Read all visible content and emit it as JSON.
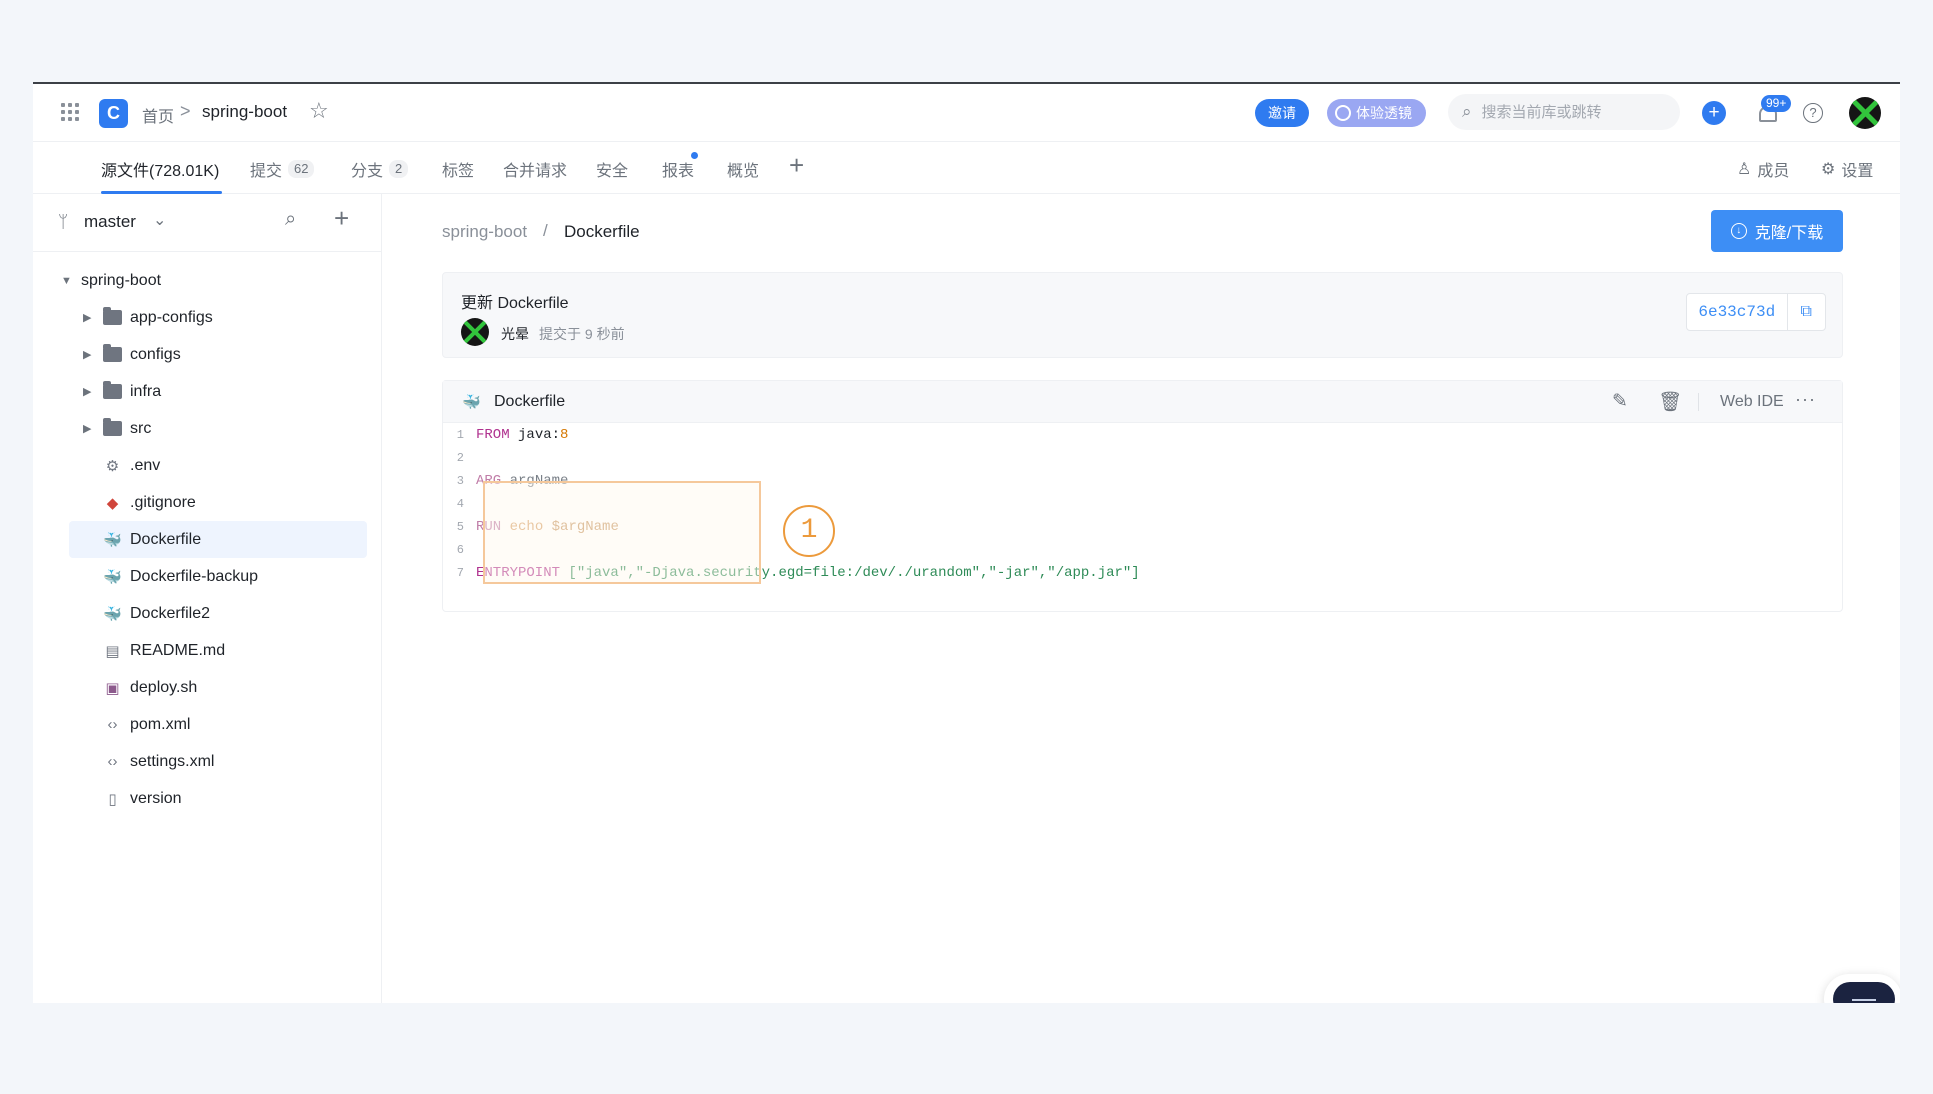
{
  "header": {
    "logo_glyph": "C",
    "breadcrumb_home": "首页",
    "breadcrumb_sep": ">",
    "repo_name": "spring-boot",
    "invite_label": "邀请",
    "trial_label": "体验透镜",
    "search_placeholder": "搜索当前库或跳转",
    "notification_badge": "99+",
    "help_glyph": "?"
  },
  "tabs": [
    {
      "label": "源文件(728.01K)",
      "count": "",
      "active": true
    },
    {
      "label": "提交",
      "count": "62"
    },
    {
      "label": "分支",
      "count": "2"
    },
    {
      "label": "标签",
      "count": ""
    },
    {
      "label": "合并请求",
      "count": ""
    },
    {
      "label": "安全",
      "count": ""
    },
    {
      "label": "报表",
      "count": "",
      "dot": true
    },
    {
      "label": "概览",
      "count": ""
    }
  ],
  "tab_actions": {
    "add": "+",
    "members": "成员",
    "settings": "设置"
  },
  "sidebar": {
    "branch": "master",
    "tree": [
      {
        "name": "spring-boot",
        "type": "root"
      },
      {
        "name": "app-configs",
        "type": "folder"
      },
      {
        "name": "configs",
        "type": "folder"
      },
      {
        "name": "infra",
        "type": "folder"
      },
      {
        "name": "src",
        "type": "folder"
      },
      {
        "name": ".env",
        "type": "file",
        "icon": "gear-icon"
      },
      {
        "name": ".gitignore",
        "type": "file",
        "icon": "git-icon"
      },
      {
        "name": "Dockerfile",
        "type": "file",
        "icon": "docker-icon",
        "selected": true
      },
      {
        "name": "Dockerfile-backup",
        "type": "file",
        "icon": "docker-icon"
      },
      {
        "name": "Dockerfile2",
        "type": "file",
        "icon": "docker-icon"
      },
      {
        "name": "README.md",
        "type": "file",
        "icon": "readme-icon"
      },
      {
        "name": "deploy.sh",
        "type": "file",
        "icon": "shell-icon"
      },
      {
        "name": "pom.xml",
        "type": "file",
        "icon": "code-icon"
      },
      {
        "name": "settings.xml",
        "type": "file",
        "icon": "code-icon"
      },
      {
        "name": "version",
        "type": "file",
        "icon": "document-icon"
      }
    ]
  },
  "main": {
    "breadcrumb_root": "spring-boot",
    "breadcrumb_sep": "/",
    "breadcrumb_file": "Dockerfile",
    "clone_label": "克隆/下载",
    "commit": {
      "title": "更新 Dockerfile",
      "author": "光晕",
      "time": "提交于 9 秒前",
      "sha": "6e33c73d"
    },
    "file": {
      "name": "Dockerfile",
      "web_ide": "Web IDE",
      "more": "···"
    },
    "code_lines": [
      {
        "n": "1",
        "kw": "FROM",
        "rest": " java:",
        "num": "8"
      },
      {
        "n": "2"
      },
      {
        "n": "3",
        "kw": "ARG",
        "rest": " argName"
      },
      {
        "n": "4"
      },
      {
        "n": "5",
        "kw": "RUN",
        "echo": " echo",
        "var": " $argName"
      },
      {
        "n": "6"
      },
      {
        "n": "7",
        "kw": "ENTRYPOINT",
        "rest": " [\"java\",\"-Djava.security.egd=file:/dev/./urandom\",\"-jar\",\"/app.jar\"]"
      }
    ],
    "annotation_marker": "1"
  },
  "colors": {
    "accent": "#2f7bf0",
    "highlight_border": "#f5c89b",
    "marker": "#ec9a3c"
  }
}
